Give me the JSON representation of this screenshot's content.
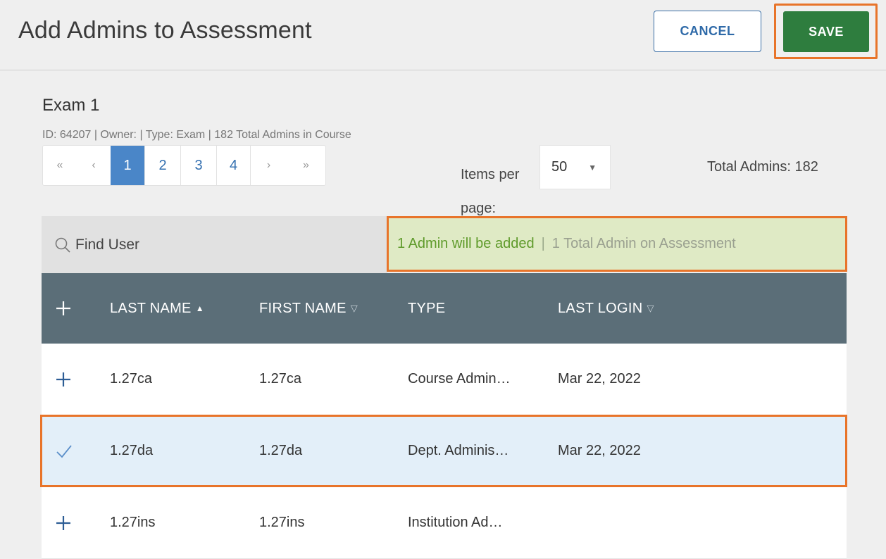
{
  "header": {
    "title": "Add Admins to Assessment",
    "cancel_label": "CANCEL",
    "save_label": "SAVE"
  },
  "assessment": {
    "name": "Exam 1",
    "meta": "ID: 64207 | Owner: | Type: Exam | 182 Total Admins in Course"
  },
  "pagination": {
    "first": "«",
    "prev": "‹",
    "pages": [
      "1",
      "2",
      "3",
      "4"
    ],
    "current_page": "1",
    "next": "›",
    "last": "»"
  },
  "items_per_page": {
    "label": "Items per page:",
    "value": "50"
  },
  "total_admins": "Total Admins: 182",
  "search": {
    "placeholder": "Find User"
  },
  "summary": {
    "added": "1 Admin will be added",
    "separator": "|",
    "total": "1 Total Admin on Assessment"
  },
  "table": {
    "columns": {
      "add": "+",
      "last_name": "LAST NAME",
      "first_name": "FIRST NAME",
      "type": "TYPE",
      "last_login": "LAST LOGIN"
    },
    "rows": [
      {
        "action": "+",
        "last_name": "1.27ca",
        "first_name": "1.27ca",
        "type": "Course Admin…",
        "last_login": "Mar 22, 2022",
        "selected": false
      },
      {
        "action": "✓",
        "last_name": "1.27da",
        "first_name": "1.27da",
        "type": "Dept. Adminis…",
        "last_login": "Mar 22, 2022",
        "selected": true
      },
      {
        "action": "+",
        "last_name": "1.27ins",
        "first_name": "1.27ins",
        "type": "Institution Ad…",
        "last_login": "",
        "selected": false
      }
    ]
  },
  "colors": {
    "save_green": "#2e7d3e",
    "highlight_orange": "#e8742a",
    "table_header": "#5b6e78",
    "selected_row": "#e3eff9",
    "summary_bg": "#dfeac5",
    "link_blue": "#3470b0"
  },
  "icons": {
    "search": "search-icon",
    "add": "plus-icon",
    "selected": "checkmark-icon",
    "sort_asc": "sort-ascending-icon",
    "sort_none": "sort-descending-outline-icon",
    "dropdown": "caret-down-icon"
  }
}
